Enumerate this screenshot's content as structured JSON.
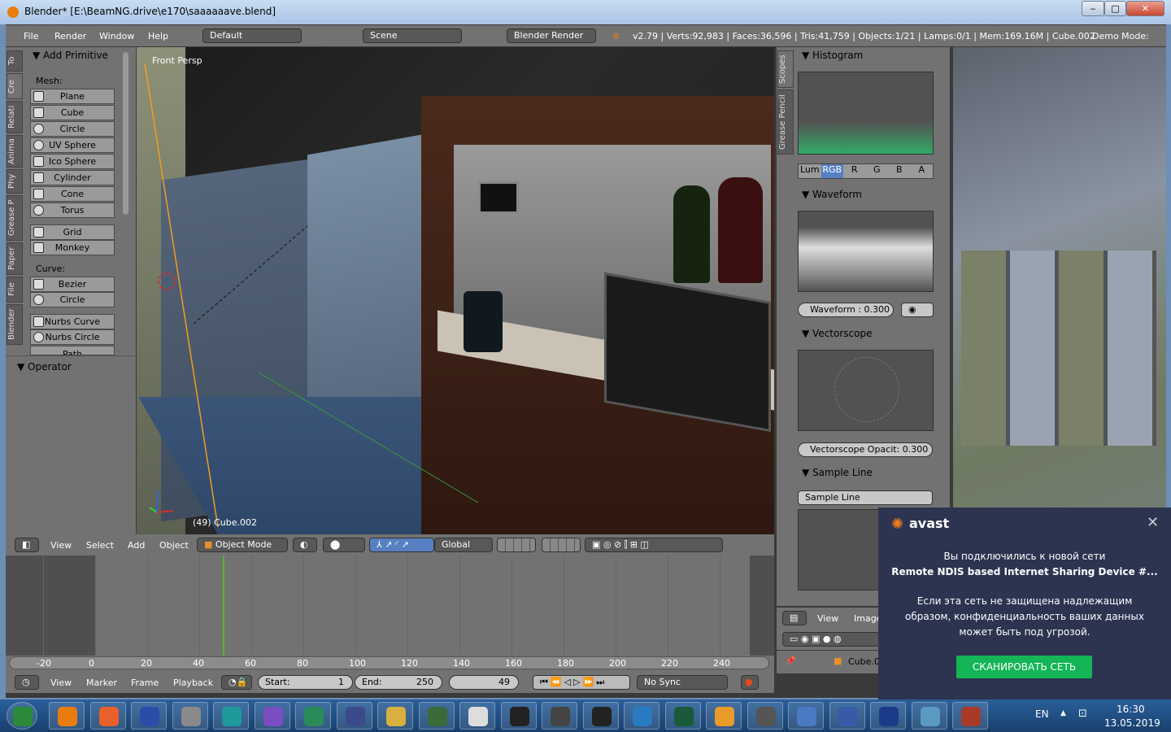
{
  "window": {
    "title": "Blender* [E:\\BeamNG.drive\\e170\\saaaaaave.blend]",
    "min": "‒",
    "max": "□",
    "close": "✕"
  },
  "info_header": {
    "menus": [
      "File",
      "Render",
      "Window",
      "Help"
    ],
    "layout": "Default",
    "scene": "Scene",
    "engine": "Blender Render",
    "stats": "v2.79 | Verts:92,983 | Faces:36,596 | Tris:41,759 | Objects:1/21 | Lamps:0/1 | Mem:169.16M | Cube.002",
    "demo": "Demo Mode:"
  },
  "toolshelf": {
    "tabs": [
      "To",
      "Cre",
      "Relati",
      "Anima",
      "Phy",
      "Grease P",
      "Paper",
      "File",
      "Blender"
    ],
    "panel_title": "Add Primitive",
    "mesh_label": "Mesh:",
    "mesh": [
      "Plane",
      "Cube",
      "Circle",
      "UV Sphere",
      "Ico Sphere",
      "Cylinder",
      "Cone",
      "Torus"
    ],
    "mesh2": [
      "Grid",
      "Monkey"
    ],
    "curve_label": "Curve:",
    "curve": [
      "Bezier",
      "Circle"
    ],
    "curve2": [
      "Nurbs Curve",
      "Nurbs Circle",
      "Path"
    ],
    "operator": "Operator"
  },
  "viewport": {
    "label": "Front Persp",
    "object": "(49) Cube.002"
  },
  "view3d_header": {
    "menus": [
      "View",
      "Select",
      "Add",
      "Object"
    ],
    "mode": "Object Mode",
    "orientation": "Global"
  },
  "timeline": {
    "ticks": [
      "-20",
      "0",
      "20",
      "40",
      "60",
      "80",
      "100",
      "120",
      "140",
      "160",
      "180",
      "200",
      "220",
      "240"
    ],
    "current_frame": 49,
    "menus": [
      "View",
      "Marker",
      "Frame",
      "Playback"
    ],
    "start_label": "Start:",
    "start": "1",
    "end_label": "End:",
    "end": "250",
    "frame": "49",
    "sync": "No Sync"
  },
  "scopes": {
    "tabs": [
      "Scopes",
      "Grease Pencil"
    ],
    "histogram": "Histogram",
    "channels": [
      "Lum",
      "RGB",
      "R",
      "G",
      "B",
      "A"
    ],
    "waveform": "Waveform",
    "waveform_opacity": "Waveform : 0.300",
    "vectorscope": "Vectorscope",
    "vectorscope_opacity": "Vectorscope Opacit:  0.300",
    "sample_line": "Sample Line",
    "sample_line_btn": "Sample Line"
  },
  "image_editor": {
    "menus": [
      "View",
      "Image"
    ],
    "object": "Cube.0"
  },
  "avast": {
    "brand": "avast",
    "line1": "Вы подключились к новой сети",
    "network": "Remote NDIS based Internet Sharing Device #...",
    "warning": "Если эта сеть не защищена надлежащим образом, конфиденциальность ваших данных может быть под угрозой.",
    "button": "СКАНИРОВАТЬ СЕТЬ",
    "accent": "#13b556"
  },
  "taskbar": {
    "lang": "EN",
    "time": "16:30",
    "date": "13.05.2019",
    "apps": [
      "Start",
      "Blender",
      "Blender Launcher",
      "App",
      "3ds Max",
      "Visual Studio",
      "Globe",
      "Audition",
      "Explorer",
      "Inkscape",
      "Paper",
      "IntelliJ",
      "Piano",
      "Synth",
      "Internet Explorer",
      "Monitor",
      "Settings",
      "Word",
      "Control Panel",
      "Sync",
      "Dev-C++",
      "Photos",
      "WinRAR",
      "Task Manager"
    ]
  }
}
